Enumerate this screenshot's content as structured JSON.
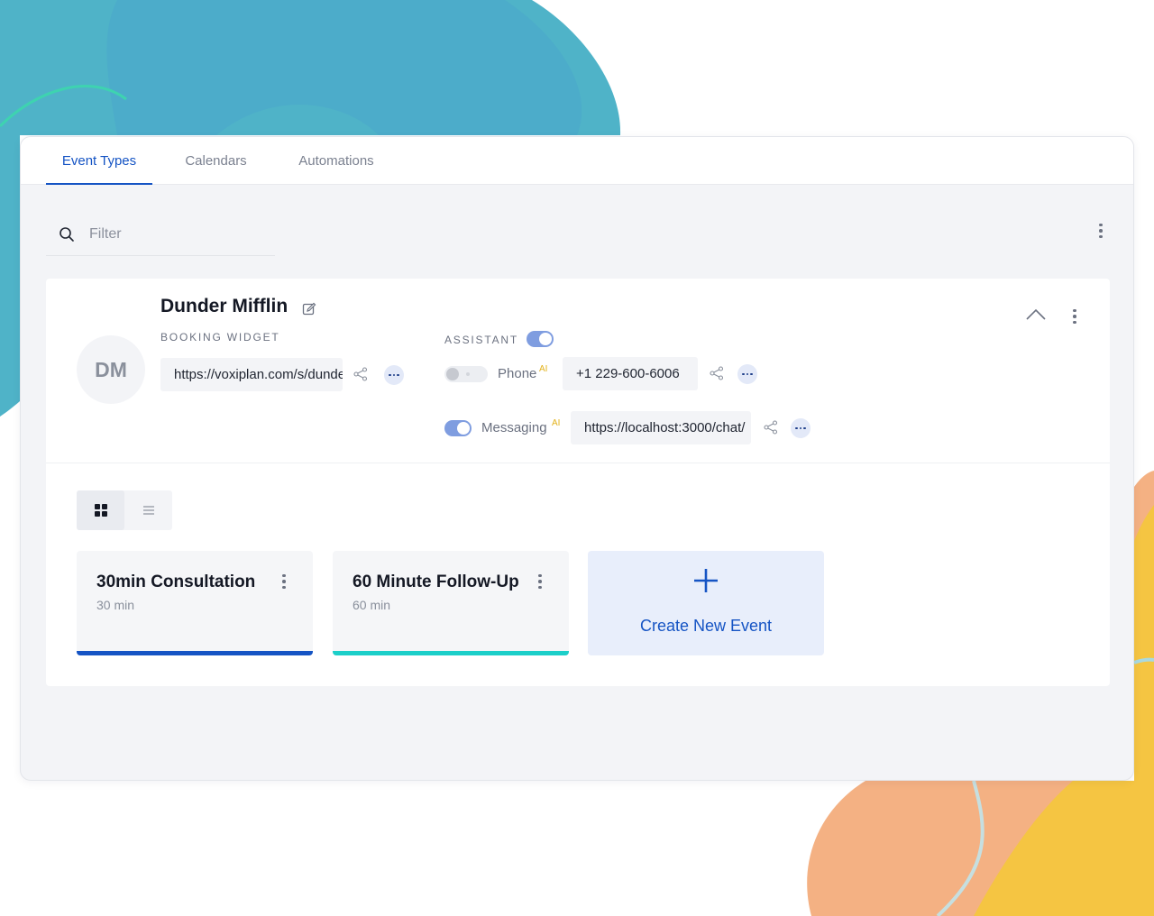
{
  "tabs": [
    {
      "label": "Event Types",
      "active": true
    },
    {
      "label": "Calendars",
      "active": false
    },
    {
      "label": "Automations",
      "active": false
    }
  ],
  "filter": {
    "placeholder": "Filter",
    "value": ""
  },
  "company": {
    "initials": "DM",
    "name": "Dunder Mifflin",
    "booking_widget_label": "BOOKING WIDGET",
    "booking_url": "https://voxiplan.com/s/dunder-mifflin",
    "assistant_label": "ASSISTANT",
    "assistant_enabled": true,
    "phone": {
      "label": "Phone",
      "ai": "AI",
      "enabled": false,
      "value": "+1 229-600-6006"
    },
    "messaging": {
      "label": "Messaging",
      "ai": "AI",
      "enabled": true,
      "value": "https://localhost:3000/chat/"
    }
  },
  "view_mode": "grid",
  "event_types": [
    {
      "title": "30min Consultation",
      "duration": "30 min",
      "color": "#1554c4"
    },
    {
      "title": "60 Minute Follow-Up",
      "duration": "60 min",
      "color": "#1ccfc9"
    }
  ],
  "create_event_label": "Create New Event",
  "colors": {
    "accent": "#1554c4",
    "ai_badge": "#e3b21c",
    "toggle_on": "#7f9de0"
  },
  "icons": [
    "search-icon",
    "kebab-menu-icon",
    "edit-icon",
    "share-icon",
    "more-horizontal-icon",
    "chevron-up-icon",
    "grid-view-icon",
    "list-view-icon",
    "plus-icon"
  ]
}
